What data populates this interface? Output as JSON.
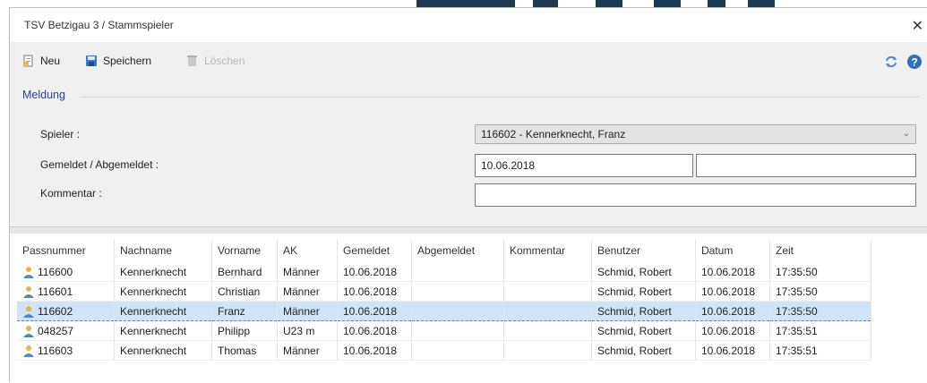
{
  "window": {
    "title": "TSV Betzigau 3 / Stammspieler",
    "close_glyph": "✕"
  },
  "toolbar": {
    "new_label": "Neu",
    "save_label": "Speichern",
    "delete_label": "Löschen",
    "icons": {
      "new": "new-document-icon",
      "save": "save-disk-icon",
      "delete": "delete-icon",
      "refresh": "refresh-icon",
      "help": "help-icon"
    }
  },
  "form": {
    "group_title": "Meldung",
    "player_label": "Spieler :",
    "player_value": "116602 - Kennerknecht, Franz",
    "registered_label": "Gemeldet / Abgemeldet :",
    "registered_value": "10.06.2018",
    "deregistered_value": "",
    "comment_label": "Kommentar :",
    "comment_value": ""
  },
  "table": {
    "columns": [
      "Passnummer",
      "Nachname",
      "Vorname",
      "AK",
      "Gemeldet",
      "Abgemeldet",
      "Kommentar",
      "Benutzer",
      "Datum",
      "Zeit"
    ],
    "rows": [
      [
        "116600",
        "Kennerknecht",
        "Bernhard",
        "Männer",
        "10.06.2018",
        "",
        "",
        "Schmid, Robert",
        "10.06.2018",
        "17:35:50"
      ],
      [
        "116601",
        "Kennerknecht",
        "Christian",
        "Männer",
        "10.06.2018",
        "",
        "",
        "Schmid, Robert",
        "10.06.2018",
        "17:35:50"
      ],
      [
        "116602",
        "Kennerknecht",
        "Franz",
        "Männer",
        "10.06.2018",
        "",
        "",
        "Schmid, Robert",
        "10.06.2018",
        "17:35:50"
      ],
      [
        "048257",
        "Kennerknecht",
        "Philipp",
        "U23 m",
        "10.06.2018",
        "",
        "",
        "Schmid, Robert",
        "10.06.2018",
        "17:35:51"
      ],
      [
        "116603",
        "Kennerknecht",
        "Thomas",
        "Männer",
        "10.06.2018",
        "",
        "",
        "Schmid, Robert",
        "10.06.2018",
        "17:35:51"
      ]
    ],
    "selected_row": 2,
    "row_icon": "user-icon"
  },
  "colors": {
    "accent": "#2a3ea8",
    "selection": "#cfe4f7"
  }
}
